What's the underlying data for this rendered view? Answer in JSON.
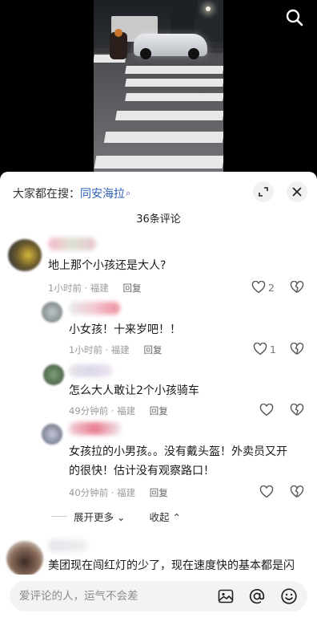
{
  "video": {
    "search_icon": "search-icon"
  },
  "panel": {
    "hot_search_prefix": "大家都在搜：",
    "hot_search_term": "同安海拉",
    "hot_search_mag": "⌕",
    "expand_icon": "expand-icon",
    "close_icon": "close-icon",
    "comment_count_title": "36条评论"
  },
  "comments": [
    {
      "text": "地上那个小孩还是大人?",
      "time": "1小时前",
      "location": "福建",
      "reply": "回复",
      "likes": "2",
      "level": 0
    },
    {
      "text": "小女孩！十来岁吧！！",
      "time": "1小时前",
      "location": "福建",
      "reply": "回复",
      "likes": "1",
      "level": 1
    },
    {
      "text": "怎么大人敢让2个小孩骑车",
      "time": "49分钟前",
      "location": "福建",
      "reply": "回复",
      "likes": "",
      "level": 1
    },
    {
      "text_line1": "女孩拉的小男孩。。没有戴头盔！外卖员又开",
      "text_line2": "的很快！估计没有观察路口！",
      "time": "40分钟前",
      "location": "福建",
      "reply": "回复",
      "likes": "",
      "level": 1
    },
    {
      "text": "美团现在闯红灯的少了，现在速度快的基本都是闪",
      "level": 0
    }
  ],
  "expand": {
    "more_label": "展开更多",
    "collapse_label": "收起"
  },
  "input": {
    "placeholder": "爱评论的人，运气不会差",
    "image_icon": "image-icon",
    "mention_icon": "at-icon",
    "emoji_icon": "emoji-icon"
  },
  "colors": {
    "link_blue": "#2d5fb8",
    "meta_gray": "#999999",
    "panel_bg": "#ffffff"
  }
}
